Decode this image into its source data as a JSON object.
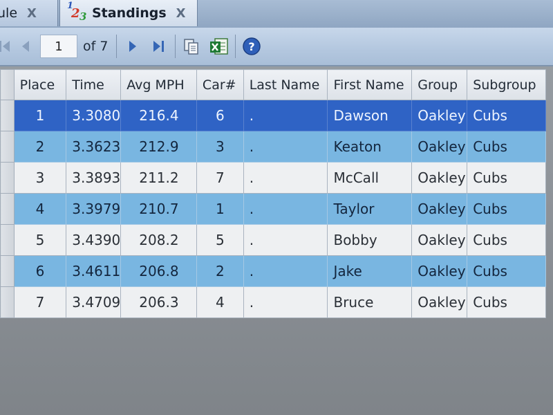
{
  "tabs": [
    {
      "label": "ule",
      "close": "X"
    },
    {
      "label": "Standings",
      "close": "X",
      "icon": "numbers-icon"
    }
  ],
  "toolbar": {
    "page_value": "1",
    "page_of": "of 7",
    "icons": [
      "first-page-icon",
      "prev-page-icon",
      "next-page-icon",
      "last-page-icon",
      "copy-icon",
      "excel-export-icon",
      "help-icon"
    ]
  },
  "grid": {
    "columns": [
      "Place",
      "Time",
      "Avg MPH",
      "Car#",
      "Last Name",
      "First Name",
      "Group",
      "Subgroup"
    ],
    "rows": [
      {
        "place": "1",
        "time": "3.3080",
        "mph": "216.4",
        "car": "6",
        "last": ".",
        "first": "Dawson",
        "group": "Oakley",
        "subgroup": "Cubs"
      },
      {
        "place": "2",
        "time": "3.3623",
        "mph": "212.9",
        "car": "3",
        "last": ".",
        "first": "Keaton",
        "group": "Oakley",
        "subgroup": "Cubs"
      },
      {
        "place": "3",
        "time": "3.3893",
        "mph": "211.2",
        "car": "7",
        "last": ".",
        "first": "McCall",
        "group": "Oakley",
        "subgroup": "Cubs"
      },
      {
        "place": "4",
        "time": "3.3979",
        "mph": "210.7",
        "car": "1",
        "last": ".",
        "first": "Taylor",
        "group": "Oakley",
        "subgroup": "Cubs"
      },
      {
        "place": "5",
        "time": "3.4390",
        "mph": "208.2",
        "car": "5",
        "last": ".",
        "first": "Bobby",
        "group": "Oakley",
        "subgroup": "Cubs"
      },
      {
        "place": "6",
        "time": "3.4611",
        "mph": "206.8",
        "car": "2",
        "last": ".",
        "first": "Jake",
        "group": "Oakley",
        "subgroup": "Cubs"
      },
      {
        "place": "7",
        "time": "3.4709",
        "mph": "206.3",
        "car": "4",
        "last": ".",
        "first": "Bruce",
        "group": "Oakley",
        "subgroup": "Cubs"
      }
    ]
  },
  "colors": {
    "selected_row": "#2f63c5",
    "alternate_row": "#79b6e1",
    "plain_row": "#eef0f2",
    "toolbar": "#b3c7df"
  }
}
